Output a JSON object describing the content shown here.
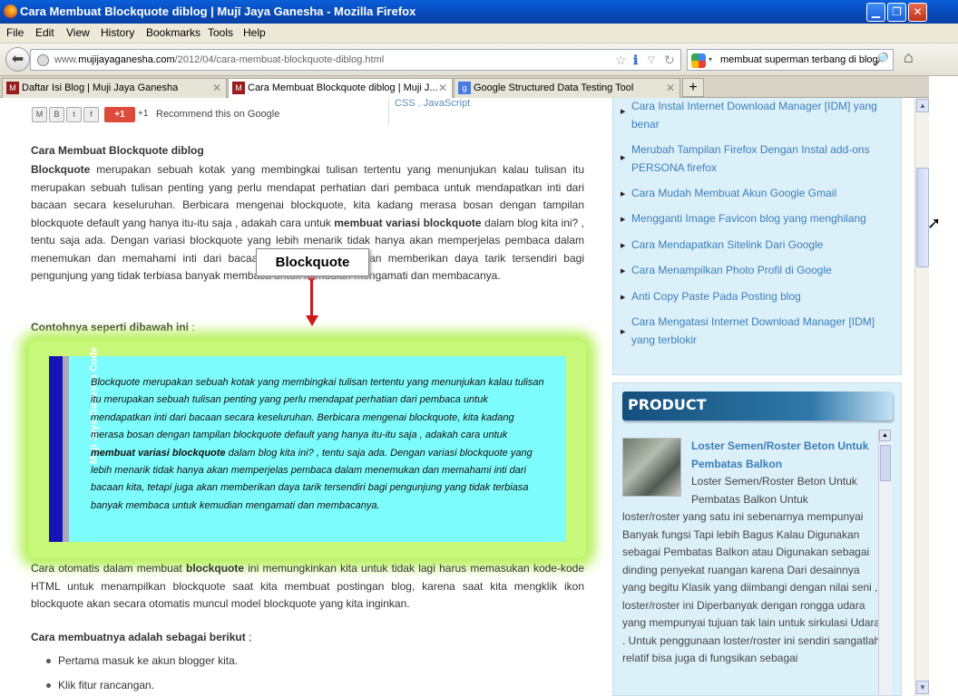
{
  "window": {
    "title": "Cara Membuat Blockquote diblog | Mujī Jaya Ganesha - Mozilla Firefox"
  },
  "menu": [
    "File",
    "Edit",
    "View",
    "History",
    "Bookmarks",
    "Tools",
    "Help"
  ],
  "address": {
    "prefix": "www.",
    "domain": "mujijayaganesha.com",
    "path": "/2012/04/cara-membuat-blockquote-diblog.html"
  },
  "search": {
    "value": "membuat superman terbang di blog"
  },
  "tabs": [
    {
      "label": "Daftar Isi Blog | Muji Jaya Ganesha"
    },
    {
      "label": "Cara Membuat Blockquote diblog | Muji J..."
    },
    {
      "label": "Google Structured Data Testing Tool"
    }
  ],
  "share": {
    "count": "+1",
    "recommend": "Recommend this on Google",
    "gplus": "+1"
  },
  "crumb": "CSS . JavaScript",
  "article": {
    "heading1": "Cara Membuat Blockquote diblog",
    "p1_bold": "Blockquote",
    "p1_a": " merupakan sebuah kotak yang membingkai tulisan tertentu yang menunjukan kalau tulisan itu merupakan sebuah tulisan penting yang perlu mendapat perhatian dari pembaca untuk mendapatkan inti dari bacaan secara keseluruhan. Berbicara mengenai blockquote, kita kadang merasa bosan dengan tampilan blockquote default yang hanya itu-itu saja , adakah cara untuk ",
    "p1_bold2": "membuat variasi blockquote",
    "p1_b": " dalam blog kita ini? , tentu saja ada. Dengan variasi blockquote yang lebih menarik tidak hanya akan memperjelas pembaca dalam menemukan dan memahami inti dari bacaan kita, tetapi juga akan memberikan daya tarik tersendiri bagi pengunjung yang tidak terbiasa banyak membaca untuk kemudian mengamati dan membacanya.",
    "heading2": "Contohnya seperti dibawah ini",
    "heading2_tail": " :",
    "callout": "Blockquote",
    "quote_side": "Muji Jaya Ganesha   Code",
    "quote_a": "Blockquote merupakan sebuah kotak yang membingkai tulisan tertentu yang menunjukan kalau tulisan itu merupakan sebuah tulisan penting yang perlu mendapat perhatian dari pembaca untuk mendapatkan inti dari bacaan secara keseluruhan. Berbicara mengenai blockquote, kita kadang merasa bosan dengan tampilan blockquote default yang hanya itu-itu saja , adakah cara untuk ",
    "quote_bold": "membuat variasi blockquote",
    "quote_b": " dalam blog kita ini? , tentu saja ada. Dengan variasi blockquote yang lebih menarik tidak hanya akan memperjelas pembaca dalam menemukan dan memahami inti dari bacaan kita, tetapi juga akan memberikan daya tarik tersendiri bagi pengunjung yang tidak terbiasa banyak membaca untuk kemudian mengamati dan membacanya.",
    "p2_a": "Cara otomatis dalam membuat ",
    "p2_bold": "blockquote",
    "p2_b": " ini memungkinkan kita untuk tidak lagi harus memasukan kode-kode HTML untuk menampilkan blockquote saat kita membuat postingan blog, karena saat kita mengklik ikon blockquote akan secara otomatis muncul model blockquote yang kita inginkan.",
    "heading3": "Cara membuatnya adalah sebagai berikut",
    "heading3_tail": " ;",
    "steps": [
      "Pertama masuk ke akun blogger kita.",
      "Klik fitur rancangan."
    ]
  },
  "sidebar": {
    "links": [
      "Cara Instal Internet Download Manager [IDM] yang benar",
      "Merubah Tampilan Firefox Dengan Instal add-ons PERSONA firefox",
      "Cara Mudah Membuat Akun Google Gmail",
      "Mengganti Image Favicon blog yang menghilang",
      "Cara Mendapatkan Sitelink Dari Google",
      "Cara Menampilkan Photo Profil di Google",
      "Anti Copy Paste Pada Posting blog",
      "Cara Mengatasi Internet Download Manager [IDM] yang terblokir"
    ],
    "product_header": "PRODUCT",
    "product_title": "Loster Semen/Roster Beton Untuk Pembatas Balkon",
    "product_desc_a": "Loster Semen/Roster Beton Untuk Pembatas Balkon Untuk",
    "product_desc_b": "loster/roster yang satu ini sebenarnya mempunyai Banyak fungsi Tapi lebih Bagus Kalau Digunakan sebagai Pembatas Balkon atau Digunakan sebagai dinding penyekat ruangan karena Dari desainnya yang begitu Klasik yang diimbangi dengan nilai seni , loster/roster ini Diperbanyak dengan rongga udara yang mempunyai tujuan tak lain untuk sirkulasi Udara . Untuk penggunaan loster/roster ini sendiri sangatlah relatif bisa juga di fungsikan sebagai"
  },
  "colors": {
    "titlebar": "#0a5fd9",
    "link": "#3a7fb8",
    "quote_bg": "#7cfcfc",
    "glow": "#b6f25a",
    "arrow": "#d01818"
  }
}
